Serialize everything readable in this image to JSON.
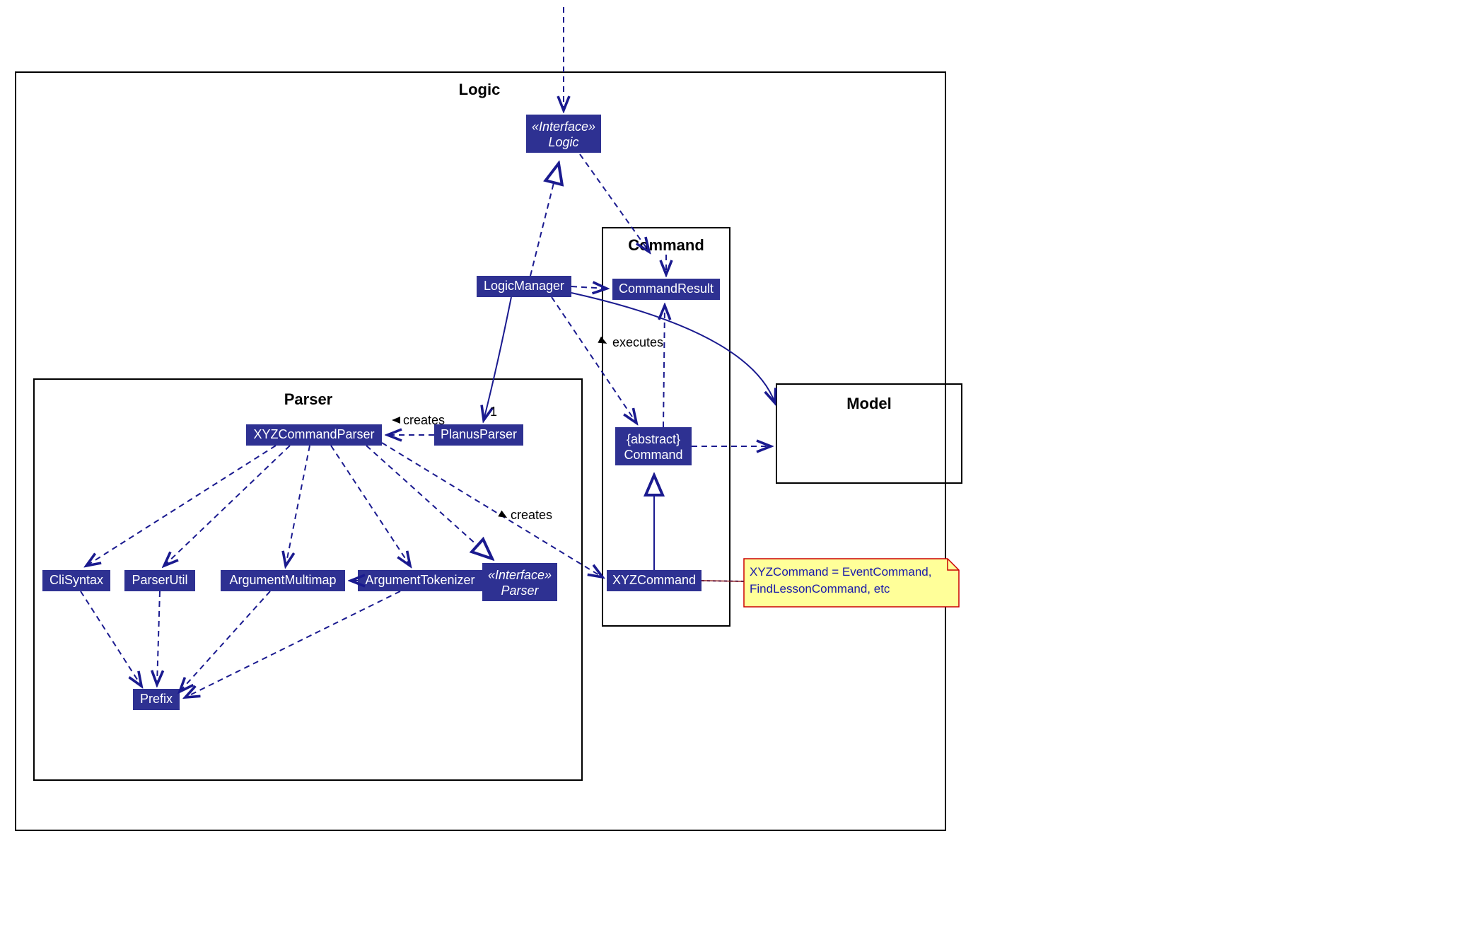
{
  "packages": {
    "logic": {
      "title": "Logic"
    },
    "parser": {
      "title": "Parser"
    },
    "command": {
      "title": "Command"
    },
    "model": {
      "title": "Model"
    }
  },
  "nodes": {
    "logic_interface": {
      "stereotype": "«Interface»",
      "name": "Logic"
    },
    "logic_manager": {
      "name": "LogicManager"
    },
    "command_result": {
      "name": "CommandResult"
    },
    "abstract_command": {
      "stereotype": "{abstract}",
      "name": "Command"
    },
    "xyz_command": {
      "name": "XYZCommand"
    },
    "xyz_command_parser": {
      "name": "XYZCommandParser"
    },
    "planus_parser": {
      "name": "PlanusParser"
    },
    "cli_syntax": {
      "name": "CliSyntax"
    },
    "parser_util": {
      "name": "ParserUtil"
    },
    "argument_multimap": {
      "name": "ArgumentMultimap"
    },
    "argument_tokenizer": {
      "name": "ArgumentTokenizer"
    },
    "parser_interface": {
      "stereotype": "«Interface»",
      "name": "Parser"
    },
    "prefix": {
      "name": "Prefix"
    }
  },
  "labels": {
    "executes": "executes",
    "creates1": "creates",
    "creates2": "creates",
    "one": "1"
  },
  "note": {
    "line1": "XYZCommand = EventCommand,",
    "line2": "FindLessonCommand, etc"
  }
}
